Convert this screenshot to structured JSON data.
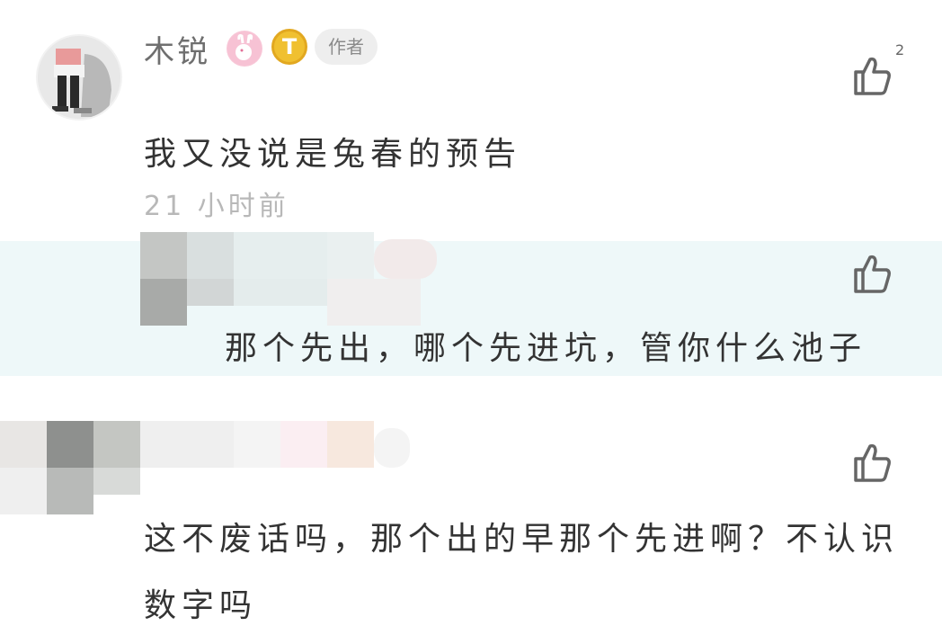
{
  "comment": {
    "username": "木锐",
    "badge_t": "T",
    "author_tag": "作者",
    "like_count": "2",
    "text": "我又没说是兔春的预告",
    "time": "21 小时前"
  },
  "replies": [
    {
      "text": "那个先出，哪个先进坑，管你什么池子"
    },
    {
      "text_line1": "这不废话吗，那个出的早那个先进啊？不认识",
      "text_line2": "数字吗"
    }
  ],
  "icons": {
    "like": "thumbs-up-icon",
    "avatar": "avatar",
    "badge_rabbit": "rabbit-badge-icon",
    "badge_t": "t-level-badge-icon"
  },
  "colors": {
    "highlight": "#eef8f9",
    "muted_text": "#b8b8b8",
    "icon": "#666666"
  }
}
